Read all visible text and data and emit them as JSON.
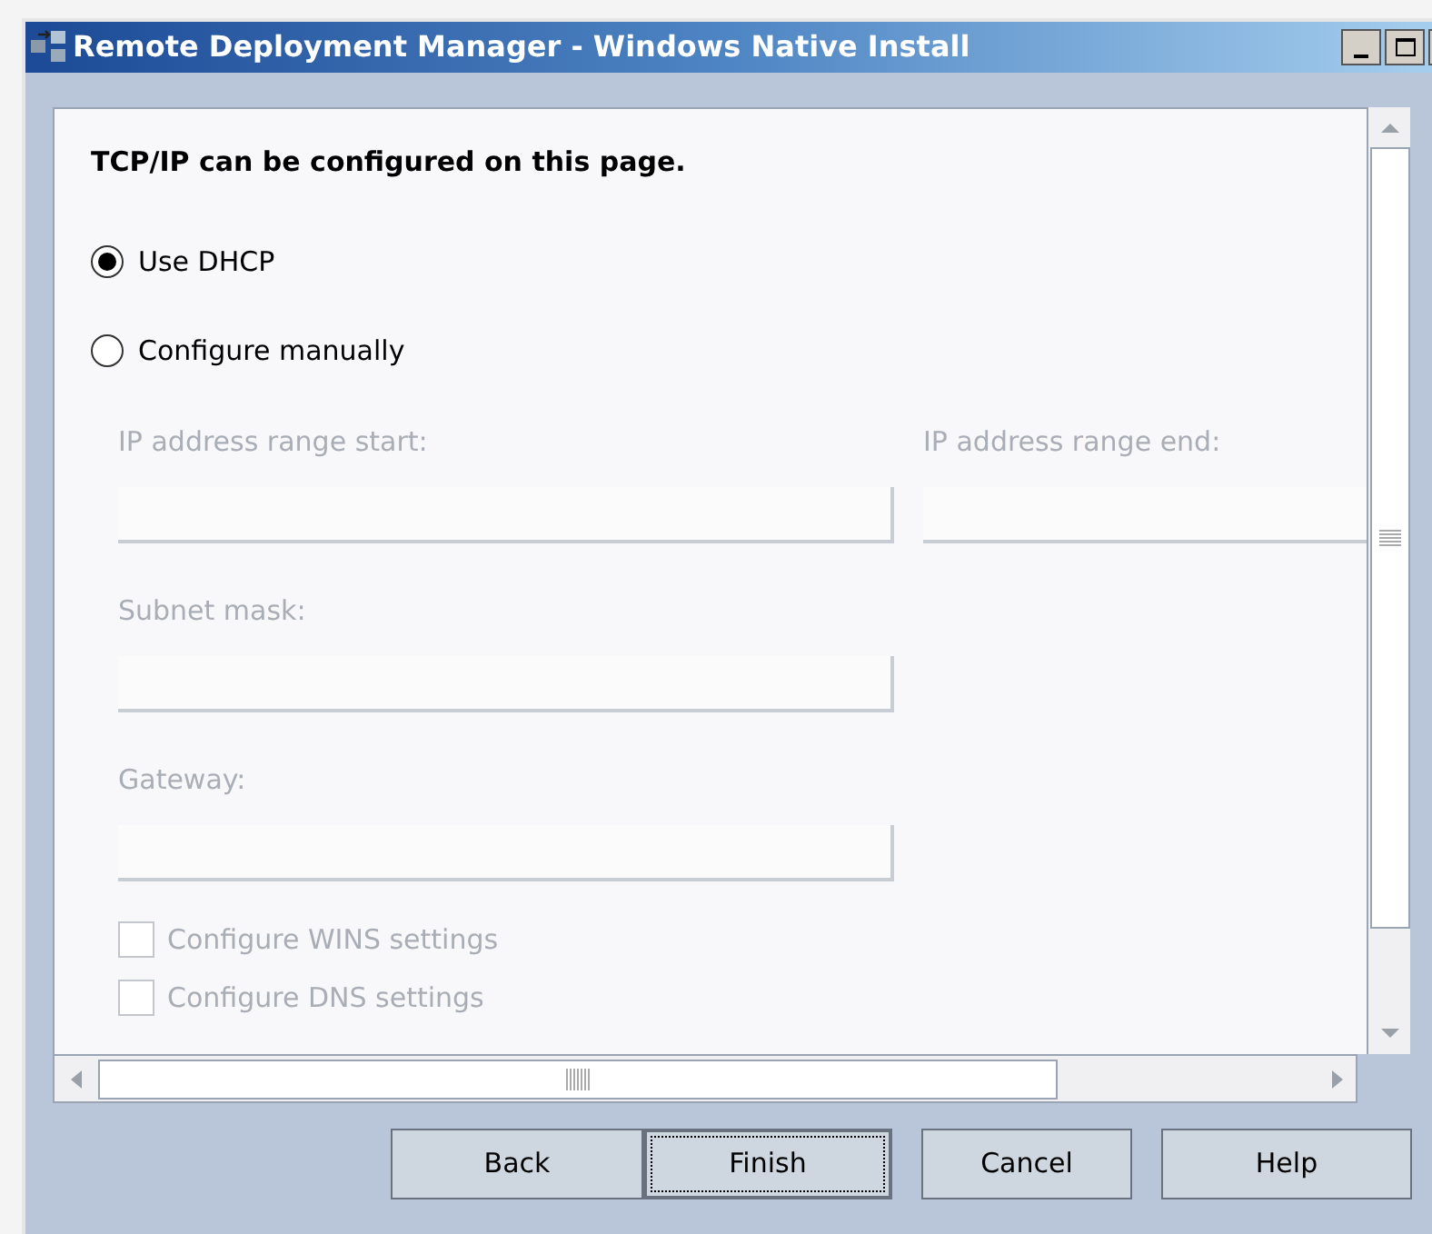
{
  "window": {
    "title": "Remote Deployment Manager - Windows Native Install"
  },
  "heading": "TCP/IP can be configured on this page.",
  "radios": [
    {
      "label": "Use DHCP",
      "selected": true
    },
    {
      "label": "Configure manually",
      "selected": false
    }
  ],
  "fields": [
    {
      "label": "IP address range start:",
      "disabled": true
    },
    {
      "label": "IP address range end:",
      "disabled": true
    },
    {
      "label": "Subnet mask:",
      "disabled": true
    },
    {
      "label": "Gateway:",
      "disabled": true
    }
  ],
  "checkboxes": [
    {
      "label": "Configure WINS settings",
      "checked": false,
      "disabled": true
    },
    {
      "label": "Configure DNS settings",
      "checked": false,
      "disabled": true
    }
  ],
  "buttons": [
    {
      "label": "Back",
      "selected": false
    },
    {
      "label": "Finish",
      "selected": true
    },
    {
      "label": "Cancel",
      "selected": false
    },
    {
      "label": "Help",
      "selected": false
    }
  ]
}
